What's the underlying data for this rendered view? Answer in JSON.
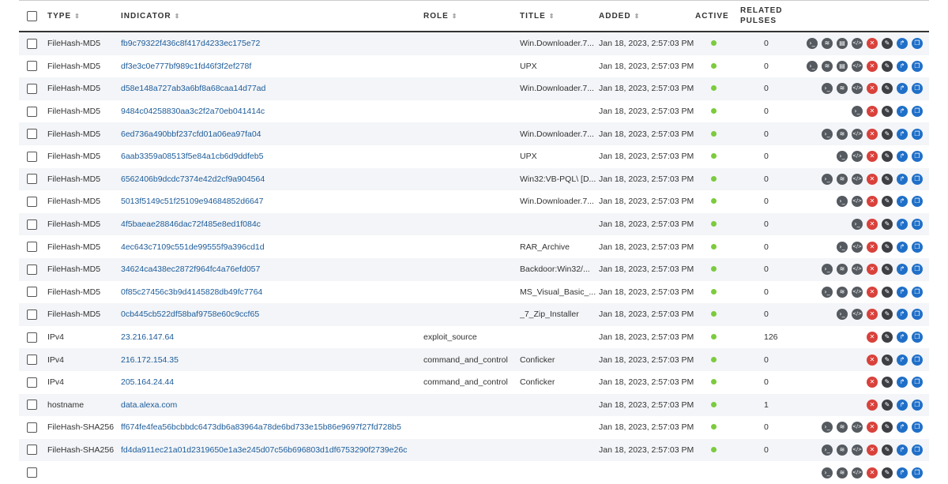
{
  "columns": {
    "type": "TYPE",
    "indicator": "INDICATOR",
    "role": "ROLE",
    "title": "TITLE",
    "added": "ADDED",
    "active": "ACTIVE",
    "related1": "RELATED",
    "related2": "PULSES"
  },
  "colors": {
    "active_dot": "#7ccb3d",
    "link": "#1c5b99",
    "delete": "#d9413b",
    "share": "#1f6fc8"
  },
  "rows": [
    {
      "type": "FileHash-MD5",
      "indicator": "fb9c79322f436c8f417d4233ec175e72",
      "role": "",
      "title": "Win.Downloader.7...",
      "added": "Jan 18, 2023, 2:57:03 PM",
      "pulses": "0",
      "actions": [
        "terminal",
        "wifi",
        "doc",
        "code",
        "delete",
        "edit",
        "share",
        "copy"
      ]
    },
    {
      "type": "FileHash-MD5",
      "indicator": "df3e3c0e777bf989c1fd46f3f2ef278f",
      "role": "",
      "title": "UPX",
      "added": "Jan 18, 2023, 2:57:03 PM",
      "pulses": "0",
      "actions": [
        "terminal",
        "wifi",
        "doc",
        "code",
        "delete",
        "edit",
        "share",
        "copy"
      ]
    },
    {
      "type": "FileHash-MD5",
      "indicator": "d58e148a727ab3a6bf8a68caa14d77ad",
      "role": "",
      "title": "Win.Downloader.7...",
      "added": "Jan 18, 2023, 2:57:03 PM",
      "pulses": "0",
      "actions": [
        "terminal",
        "wifi",
        "code",
        "delete",
        "edit",
        "share",
        "copy"
      ]
    },
    {
      "type": "FileHash-MD5",
      "indicator": "9484c04258830aa3c2f2a70eb041414c",
      "role": "",
      "title": "",
      "added": "Jan 18, 2023, 2:57:03 PM",
      "pulses": "0",
      "actions": [
        "terminal",
        "delete",
        "edit",
        "share",
        "copy"
      ]
    },
    {
      "type": "FileHash-MD5",
      "indicator": "6ed736a490bbf237cfd01a06ea97fa04",
      "role": "",
      "title": "Win.Downloader.7...",
      "added": "Jan 18, 2023, 2:57:03 PM",
      "pulses": "0",
      "actions": [
        "terminal",
        "wifi",
        "code",
        "delete",
        "edit",
        "share",
        "copy"
      ]
    },
    {
      "type": "FileHash-MD5",
      "indicator": "6aab3359a08513f5e84a1cb6d9ddfeb5",
      "role": "",
      "title": "UPX",
      "added": "Jan 18, 2023, 2:57:03 PM",
      "pulses": "0",
      "actions": [
        "terminal",
        "code",
        "delete",
        "edit",
        "share",
        "copy"
      ]
    },
    {
      "type": "FileHash-MD5",
      "indicator": "6562406b9dcdc7374e42d2cf9a904564",
      "role": "",
      "title": "Win32:VB-PQL\\ [D...",
      "added": "Jan 18, 2023, 2:57:03 PM",
      "pulses": "0",
      "actions": [
        "terminal",
        "wifi",
        "code",
        "delete",
        "edit",
        "share",
        "copy"
      ]
    },
    {
      "type": "FileHash-MD5",
      "indicator": "5013f5149c51f25109e94684852d6647",
      "role": "",
      "title": "Win.Downloader.7...",
      "added": "Jan 18, 2023, 2:57:03 PM",
      "pulses": "0",
      "actions": [
        "terminal",
        "code",
        "delete",
        "edit",
        "share",
        "copy"
      ]
    },
    {
      "type": "FileHash-MD5",
      "indicator": "4f5baeae28846dac72f485e8ed1f084c",
      "role": "",
      "title": "",
      "added": "Jan 18, 2023, 2:57:03 PM",
      "pulses": "0",
      "actions": [
        "terminal",
        "delete",
        "edit",
        "share",
        "copy"
      ]
    },
    {
      "type": "FileHash-MD5",
      "indicator": "4ec643c7109c551de99555f9a396cd1d",
      "role": "",
      "title": "RAR_Archive",
      "added": "Jan 18, 2023, 2:57:03 PM",
      "pulses": "0",
      "actions": [
        "terminal",
        "code",
        "delete",
        "edit",
        "share",
        "copy"
      ]
    },
    {
      "type": "FileHash-MD5",
      "indicator": "34624ca438ec2872f964fc4a76efd057",
      "role": "",
      "title": "Backdoor:Win32/...",
      "added": "Jan 18, 2023, 2:57:03 PM",
      "pulses": "0",
      "actions": [
        "terminal",
        "wifi",
        "code",
        "delete",
        "edit",
        "share",
        "copy"
      ]
    },
    {
      "type": "FileHash-MD5",
      "indicator": "0f85c27456c3b9d4145828db49fc7764",
      "role": "",
      "title": "MS_Visual_Basic_...",
      "added": "Jan 18, 2023, 2:57:03 PM",
      "pulses": "0",
      "actions": [
        "terminal",
        "wifi",
        "code",
        "delete",
        "edit",
        "share",
        "copy"
      ]
    },
    {
      "type": "FileHash-MD5",
      "indicator": "0cb445cb522df58baf9758e60c9ccf65",
      "role": "",
      "title": "_7_Zip_Installer",
      "added": "Jan 18, 2023, 2:57:03 PM",
      "pulses": "0",
      "actions": [
        "terminal",
        "code",
        "delete",
        "edit",
        "share",
        "copy"
      ]
    },
    {
      "type": "IPv4",
      "indicator": "23.216.147.64",
      "role": "exploit_source",
      "title": "",
      "added": "Jan 18, 2023, 2:57:03 PM",
      "pulses": "126",
      "actions": [
        "delete",
        "edit",
        "share",
        "copy"
      ]
    },
    {
      "type": "IPv4",
      "indicator": "216.172.154.35",
      "role": "command_and_control",
      "title": "Conficker",
      "added": "Jan 18, 2023, 2:57:03 PM",
      "pulses": "0",
      "actions": [
        "delete",
        "edit",
        "share",
        "copy"
      ]
    },
    {
      "type": "IPv4",
      "indicator": "205.164.24.44",
      "role": "command_and_control",
      "title": "Conficker",
      "added": "Jan 18, 2023, 2:57:03 PM",
      "pulses": "0",
      "actions": [
        "delete",
        "edit",
        "share",
        "copy"
      ]
    },
    {
      "type": "hostname",
      "indicator": "data.alexa.com",
      "role": "",
      "title": "",
      "added": "Jan 18, 2023, 2:57:03 PM",
      "pulses": "1",
      "actions": [
        "delete",
        "edit",
        "share",
        "copy"
      ]
    },
    {
      "type": "FileHash-SHA256",
      "indicator": "ff674fe4fea56bcbbdc6473db6a83964a78de6bd733e15b86e9697f27fd728b5",
      "role": "",
      "title": "",
      "added": "Jan 18, 2023, 2:57:03 PM",
      "pulses": "0",
      "actions": [
        "terminal",
        "wifi",
        "code",
        "delete",
        "edit",
        "share",
        "copy"
      ]
    },
    {
      "type": "FileHash-SHA256",
      "indicator": "fd4da911ec21a01d2319650e1a3e245d07c56b696803d1df6753290f2739e26c",
      "role": "",
      "title": "",
      "added": "Jan 18, 2023, 2:57:03 PM",
      "pulses": "0",
      "actions": [
        "terminal",
        "wifi",
        "code",
        "delete",
        "edit",
        "share",
        "copy"
      ]
    },
    {
      "type": "",
      "indicator": "",
      "role": "",
      "title": "",
      "added": "",
      "pulses": "",
      "actions": [
        "terminal",
        "wifi",
        "code",
        "delete",
        "edit",
        "share",
        "copy"
      ]
    }
  ]
}
